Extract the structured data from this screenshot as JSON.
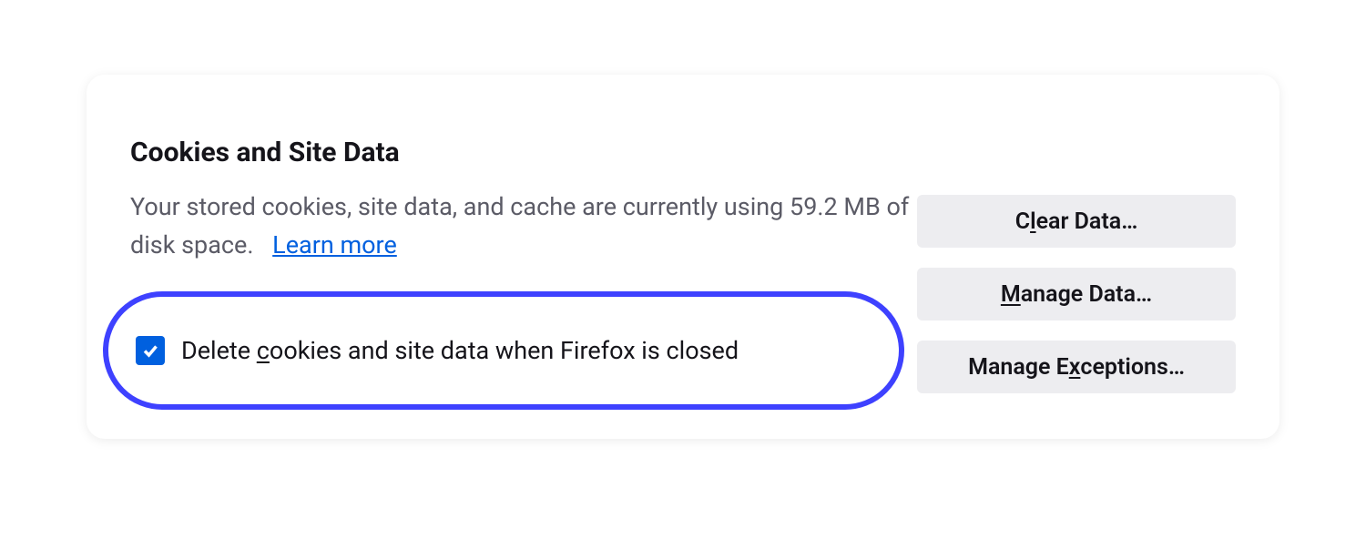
{
  "section": {
    "title": "Cookies and Site Data",
    "description_pre": "Your stored cookies, site data, and cache are currently using ",
    "storage_used": "59.2 MB",
    "description_post": " of disk space.",
    "learn_more": "Learn more"
  },
  "checkbox": {
    "checked": true,
    "label_pre": "Delete ",
    "label_accessor": "c",
    "label_post": "ookies and site data when Firefox is closed"
  },
  "buttons": {
    "clear_pre": "C",
    "clear_accessor": "l",
    "clear_post": "ear Data…",
    "manage_data_accessor": "M",
    "manage_data_post": "anage Data…",
    "manage_exceptions_pre": "Manage E",
    "manage_exceptions_accessor": "x",
    "manage_exceptions_post": "ceptions…"
  }
}
